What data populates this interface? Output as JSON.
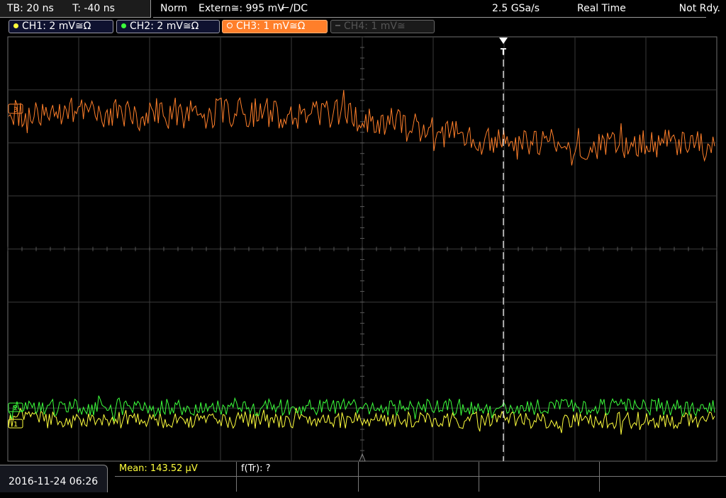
{
  "status_bar": {
    "timebase": "TB: 20 ns",
    "trigger_time": "T: -40 ns",
    "mode": "Norm",
    "trigger_source": "Extern≅: 995 mV",
    "trigger_slope_coupling": "⌐/DC",
    "sample_rate": "2.5 GSa/s",
    "acquisition": "Real Time",
    "run_state": "Not Rdy."
  },
  "channels": [
    {
      "label": "CH1: 2 mV≅Ω",
      "color": "#ffff3c",
      "active": true
    },
    {
      "label": "CH2: 2 mV≅Ω",
      "color": "#3cff3c",
      "active": true
    },
    {
      "label": "CH3: 1 mV≅Ω",
      "color": "#ff7f2a",
      "active": true
    },
    {
      "label": "CH4: 1 mV≅",
      "color": "#555555",
      "active": false
    }
  ],
  "markers": {
    "trigger_marker": "T",
    "ch1_marker": "1",
    "ch2_marker": "2",
    "ch3_marker": "3"
  },
  "measurements": {
    "mean": "Mean: 143.52 µV",
    "f_tr": "f(Tr): ?"
  },
  "datetime": "2016-11-24 06:26",
  "colors": {
    "grid": "#3a3a3a",
    "ch1": "#ffff3c",
    "ch2": "#3cff3c",
    "ch3": "#ff7f2a",
    "trigger_line": "#ffffff"
  }
}
